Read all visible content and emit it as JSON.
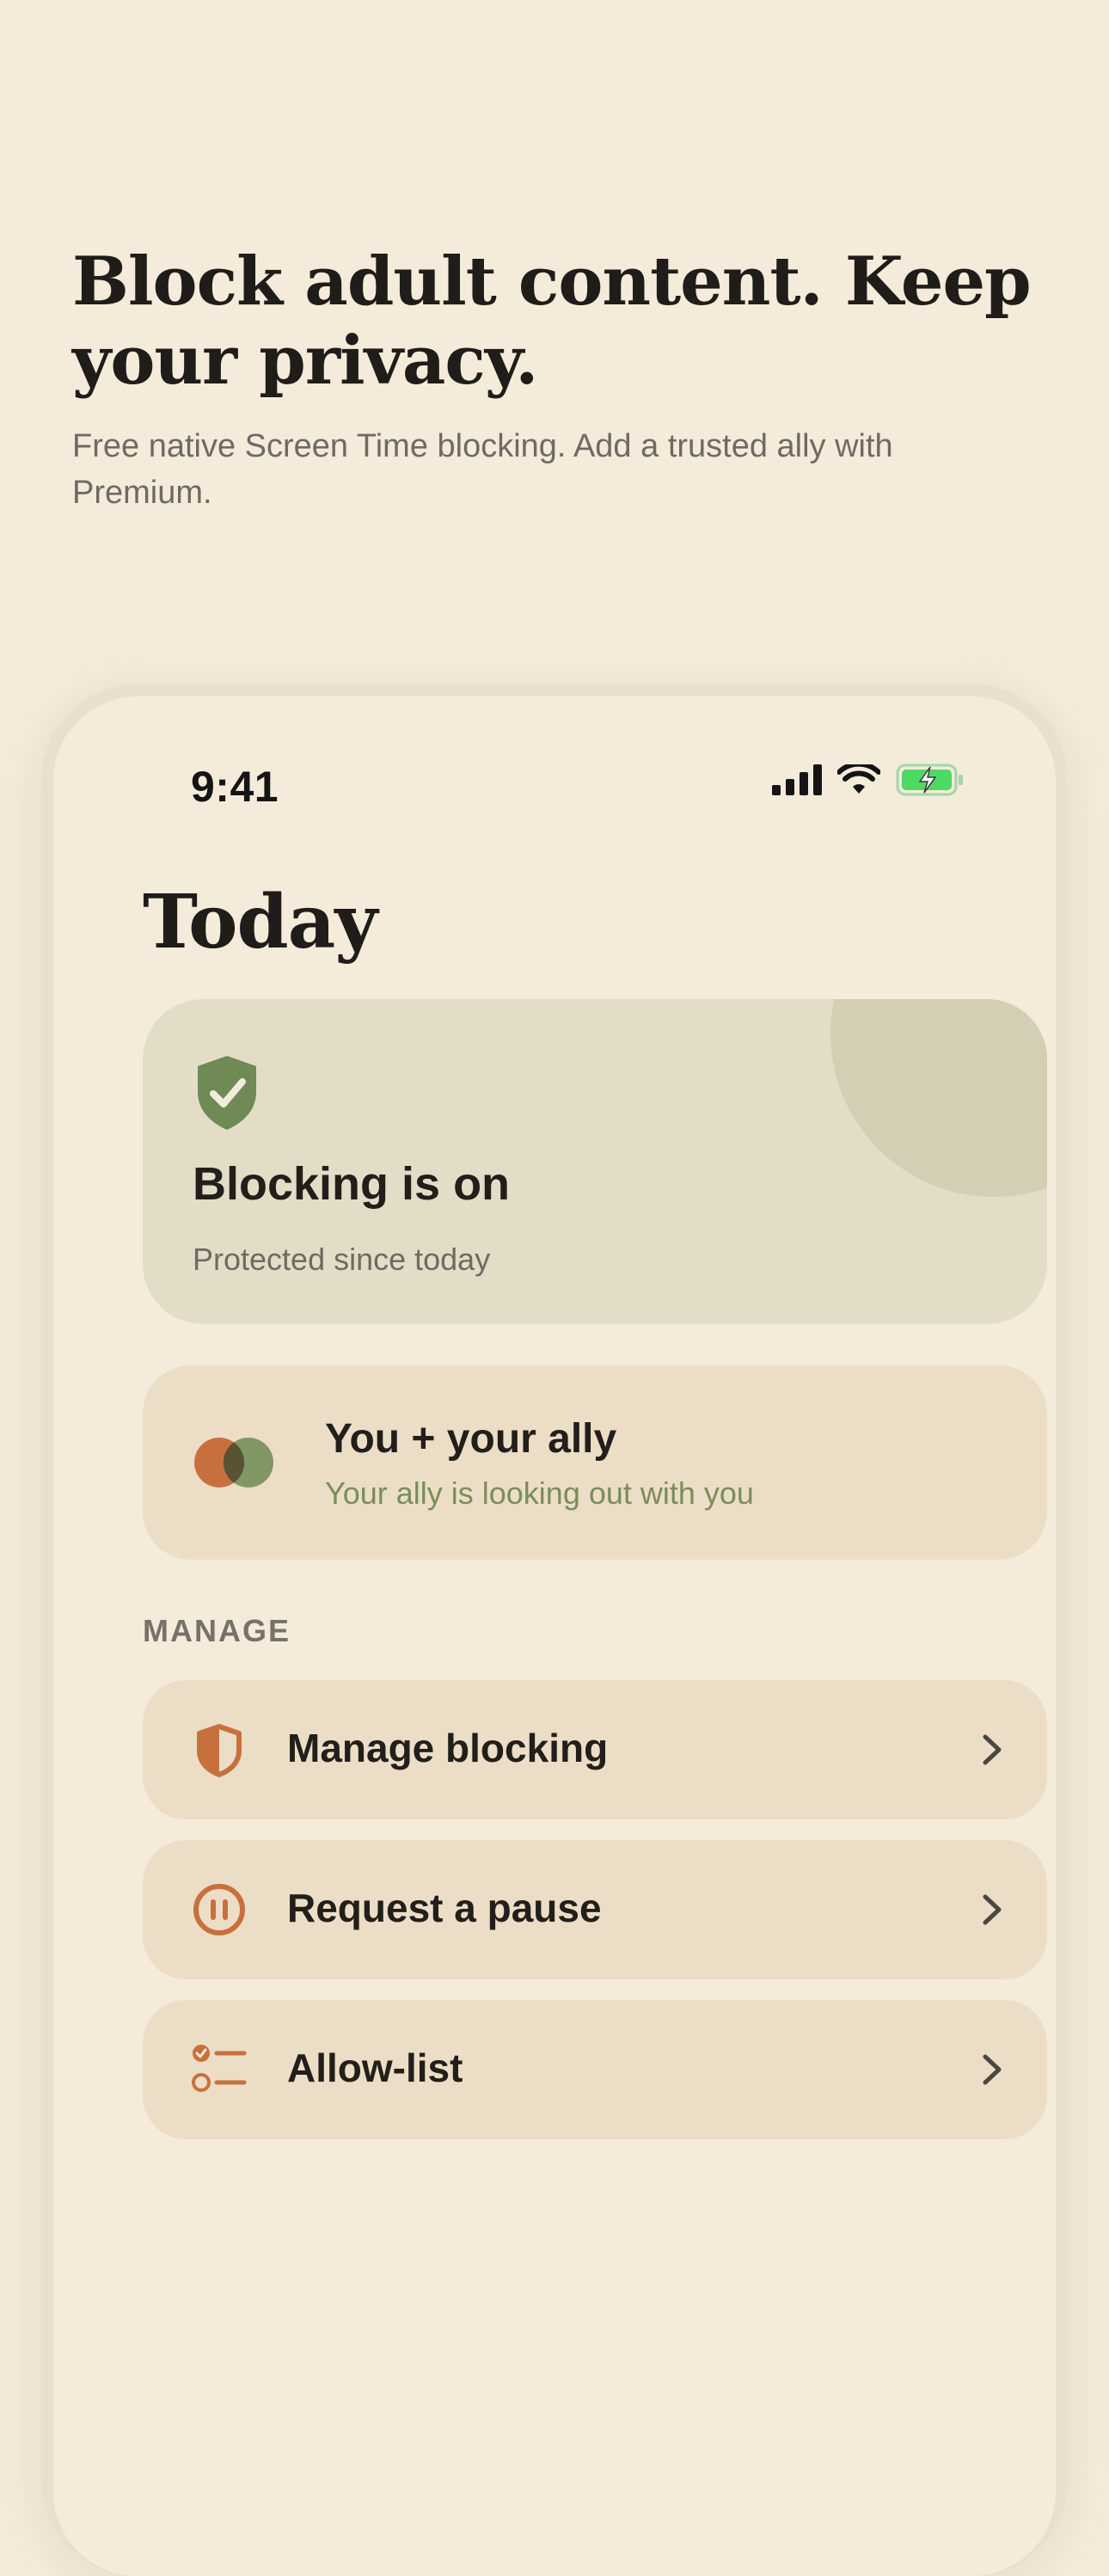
{
  "hero": {
    "title": "Block adult content. Keep your privacy.",
    "subtitle": "Free native Screen Time blocking. Add a trusted ally with Premium."
  },
  "status_bar": {
    "time": "9:41",
    "icons": [
      "cellular-signal-icon",
      "wifi-icon",
      "battery-charging-icon"
    ]
  },
  "screen": {
    "title": "Today",
    "blocking_card": {
      "icon": "shield-check-icon",
      "title": "Blocking is on",
      "subtitle": "Protected since today"
    },
    "ally_card": {
      "icon": "overlapping-circles-icon",
      "title": "You + your ally",
      "subtitle": "Your ally is looking out with you"
    },
    "manage": {
      "label": "MANAGE",
      "items": [
        {
          "label": "Manage blocking",
          "icon": "shield-half-icon"
        },
        {
          "label": "Request a pause",
          "icon": "pause-circle-icon"
        },
        {
          "label": "Allow-list",
          "icon": "checklist-icon"
        }
      ]
    }
  },
  "colors": {
    "background": "#f5ebdb",
    "accent_orange": "#c8703d",
    "accent_green": "#6f8a54",
    "card_green": "#e3ddc7",
    "card_tan": "#ecdec6",
    "battery_green": "#4cd964"
  }
}
